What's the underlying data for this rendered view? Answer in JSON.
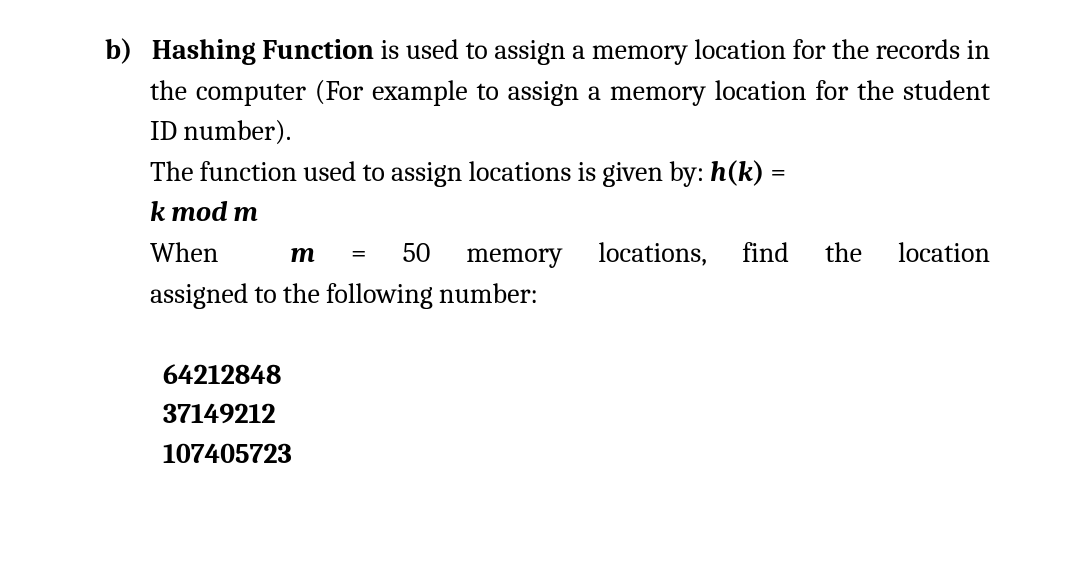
{
  "problem": {
    "label": "b)",
    "bold_term": "Hashing Function",
    "intro_text_1": " is used to assign a memory location for the records in the computer (For example to assign a memory location for the student ID number).",
    "func_text_pre": "The function used to assign locations is given by: ",
    "func_h": "h",
    "func_paren_open": "(",
    "func_k": "k",
    "func_paren_close": ")",
    "func_equals": " =",
    "func_expr_k": "k",
    "func_expr_mod": " mod ",
    "func_expr_m": "m",
    "when_text_1": "When",
    "when_m": "m",
    "when_eq": " = 50",
    "when_text_2": "memory",
    "when_text_3": "locations,",
    "when_text_4": "find",
    "when_text_5": "the",
    "when_text_6": "location",
    "when_line2": "assigned to the following number:",
    "numbers": [
      "64212848",
      "37149212",
      "107405723"
    ]
  }
}
